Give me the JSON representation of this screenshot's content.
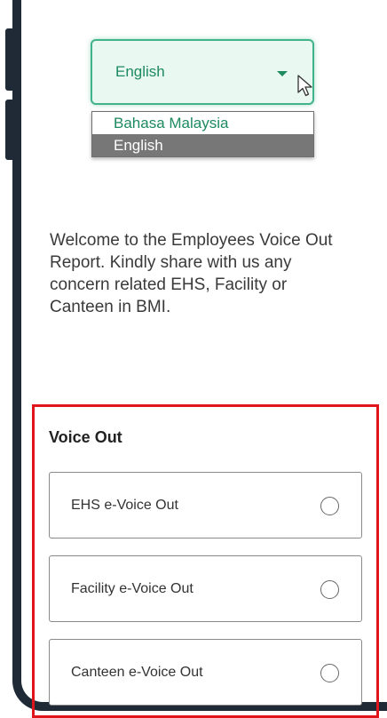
{
  "language": {
    "selected": "English",
    "options": [
      "Bahasa Malaysia",
      "English"
    ],
    "highlighted_option": "English"
  },
  "welcome_text": "Welcome to the Employees Voice Out Report. Kindly share with us any concern related EHS, Facility or Canteen in BMI.",
  "voice_out": {
    "title": "Voice Out",
    "options": [
      {
        "label": "EHS e-Voice Out",
        "selected": false
      },
      {
        "label": "Facility e-Voice Out",
        "selected": false
      },
      {
        "label": "Canteen e-Voice Out",
        "selected": false
      }
    ]
  },
  "colors": {
    "accent": "#41b38a",
    "accent_text": "#1e8a5f",
    "highlight_box": "#e0141b",
    "frame": "#1f2a36",
    "option_highlight": "#777777"
  },
  "icons": {
    "dropdown": "caret-down-icon",
    "pointer": "mouse-cursor-icon",
    "radio": "radio-unchecked-icon"
  }
}
